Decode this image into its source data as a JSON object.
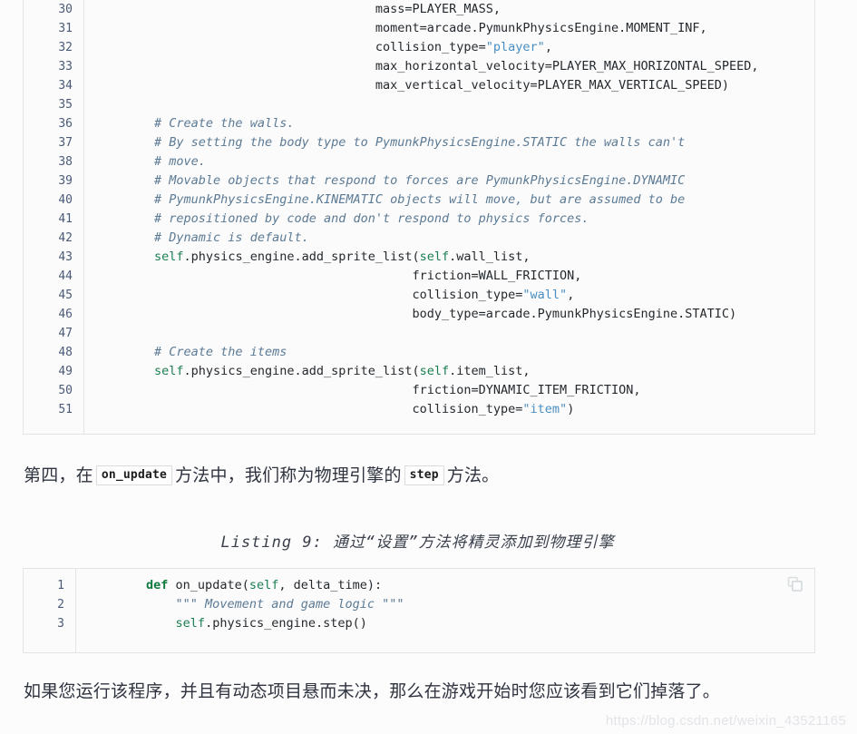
{
  "code_block_one": {
    "language": "python",
    "line_numbers": [
      "30",
      "31",
      "32",
      "33",
      "34",
      "35",
      "36",
      "37",
      "38",
      "39",
      "40",
      "41",
      "42",
      "43",
      "44",
      "45",
      "46",
      "47",
      "48",
      "49",
      "50",
      "51"
    ],
    "lines": [
      {
        "indent": "                                      ",
        "segments": [
          {
            "t": "mass=PLAYER_MASS,",
            "k": "plain"
          }
        ]
      },
      {
        "indent": "                                      ",
        "segments": [
          {
            "t": "moment=arcade.PymunkPhysicsEngine.MOMENT_INF,",
            "k": "plain"
          }
        ]
      },
      {
        "indent": "                                      ",
        "segments": [
          {
            "t": "collision_type=",
            "k": "plain"
          },
          {
            "t": "\"player\"",
            "k": "str"
          },
          {
            "t": ",",
            "k": "plain"
          }
        ]
      },
      {
        "indent": "                                      ",
        "segments": [
          {
            "t": "max_horizontal_velocity=PLAYER_MAX_HORIZONTAL_SPEED,",
            "k": "plain"
          }
        ]
      },
      {
        "indent": "                                      ",
        "segments": [
          {
            "t": "max_vertical_velocity=PLAYER_MAX_VERTICAL_SPEED)",
            "k": "plain"
          }
        ]
      },
      {
        "indent": "",
        "segments": []
      },
      {
        "indent": "        ",
        "segments": [
          {
            "t": "# Create the walls.",
            "k": "com"
          }
        ]
      },
      {
        "indent": "        ",
        "segments": [
          {
            "t": "# By setting the body type to PymunkPhysicsEngine.STATIC the walls can't",
            "k": "com"
          }
        ]
      },
      {
        "indent": "        ",
        "segments": [
          {
            "t": "# move.",
            "k": "com"
          }
        ]
      },
      {
        "indent": "        ",
        "segments": [
          {
            "t": "# Movable objects that respond to forces are PymunkPhysicsEngine.DYNAMIC",
            "k": "com"
          }
        ]
      },
      {
        "indent": "        ",
        "segments": [
          {
            "t": "# PymunkPhysicsEngine.KINEMATIC objects will move, but are assumed to be",
            "k": "com"
          }
        ]
      },
      {
        "indent": "        ",
        "segments": [
          {
            "t": "# repositioned by code and don't respond to physics forces.",
            "k": "com"
          }
        ]
      },
      {
        "indent": "        ",
        "segments": [
          {
            "t": "# Dynamic is default.",
            "k": "com"
          }
        ]
      },
      {
        "indent": "        ",
        "segments": [
          {
            "t": "self",
            "k": "self"
          },
          {
            "t": ".physics_engine.add_sprite_list(",
            "k": "plain"
          },
          {
            "t": "self",
            "k": "self"
          },
          {
            "t": ".wall_list,",
            "k": "plain"
          }
        ]
      },
      {
        "indent": "                                           ",
        "segments": [
          {
            "t": "friction=WALL_FRICTION,",
            "k": "plain"
          }
        ]
      },
      {
        "indent": "                                           ",
        "segments": [
          {
            "t": "collision_type=",
            "k": "plain"
          },
          {
            "t": "\"wall\"",
            "k": "str"
          },
          {
            "t": ",",
            "k": "plain"
          }
        ]
      },
      {
        "indent": "                                           ",
        "segments": [
          {
            "t": "body_type=arcade.PymunkPhysicsEngine.STATIC)",
            "k": "plain"
          }
        ]
      },
      {
        "indent": "",
        "segments": []
      },
      {
        "indent": "        ",
        "segments": [
          {
            "t": "# Create the items",
            "k": "com"
          }
        ]
      },
      {
        "indent": "        ",
        "segments": [
          {
            "t": "self",
            "k": "self"
          },
          {
            "t": ".physics_engine.add_sprite_list(",
            "k": "plain"
          },
          {
            "t": "self",
            "k": "self"
          },
          {
            "t": ".item_list,",
            "k": "plain"
          }
        ]
      },
      {
        "indent": "                                           ",
        "segments": [
          {
            "t": "friction=DYNAMIC_ITEM_FRICTION,",
            "k": "plain"
          }
        ]
      },
      {
        "indent": "                                           ",
        "segments": [
          {
            "t": "collision_type=",
            "k": "plain"
          },
          {
            "t": "\"item\"",
            "k": "str"
          },
          {
            "t": ")",
            "k": "plain"
          }
        ]
      }
    ]
  },
  "paragraph_one": {
    "part1": "第四，在",
    "code1": "on_update",
    "part2": "方法中，我们称为物理引擎的",
    "code2": "step",
    "part3": "方法。"
  },
  "listing_caption": "Listing 9: 通过“设置”方法将精灵添加到物理引擎",
  "code_block_two": {
    "language": "python",
    "copy_icon": "copy-icon",
    "line_numbers": [
      "1",
      "2",
      "3"
    ],
    "lines": [
      {
        "indent": "        ",
        "segments": [
          {
            "t": "def",
            "k": "kw"
          },
          {
            "t": " on_update(",
            "k": "plain"
          },
          {
            "t": "self",
            "k": "self"
          },
          {
            "t": ", delta_time):",
            "k": "plain"
          }
        ]
      },
      {
        "indent": "            ",
        "segments": [
          {
            "t": "\"\"\" Movement and game logic \"\"\"",
            "k": "doc"
          }
        ]
      },
      {
        "indent": "            ",
        "segments": [
          {
            "t": "self",
            "k": "self"
          },
          {
            "t": ".physics_engine.step()",
            "k": "plain"
          }
        ]
      }
    ]
  },
  "paragraph_two": {
    "text": "如果您运行该程序，并且有动态项目悬而未决，那么在游戏开始时您应该看到它们掉落了。"
  },
  "watermark": {
    "text": "https://blog.csdn.net/weixin_43521165"
  },
  "colors": {
    "page_background": "#fcfcfc",
    "code_background": "#fbfbfb",
    "code_border": "#e4e4e4",
    "line_number": "#4a5b78",
    "code_text": "#24292e",
    "comment": "#5b7a95",
    "string": "#4a8fc4",
    "self_keyword": "#1a7f52",
    "keyword": "#0f7b3e",
    "body_text": "#2f3440",
    "watermark": "#e2e4e8"
  }
}
